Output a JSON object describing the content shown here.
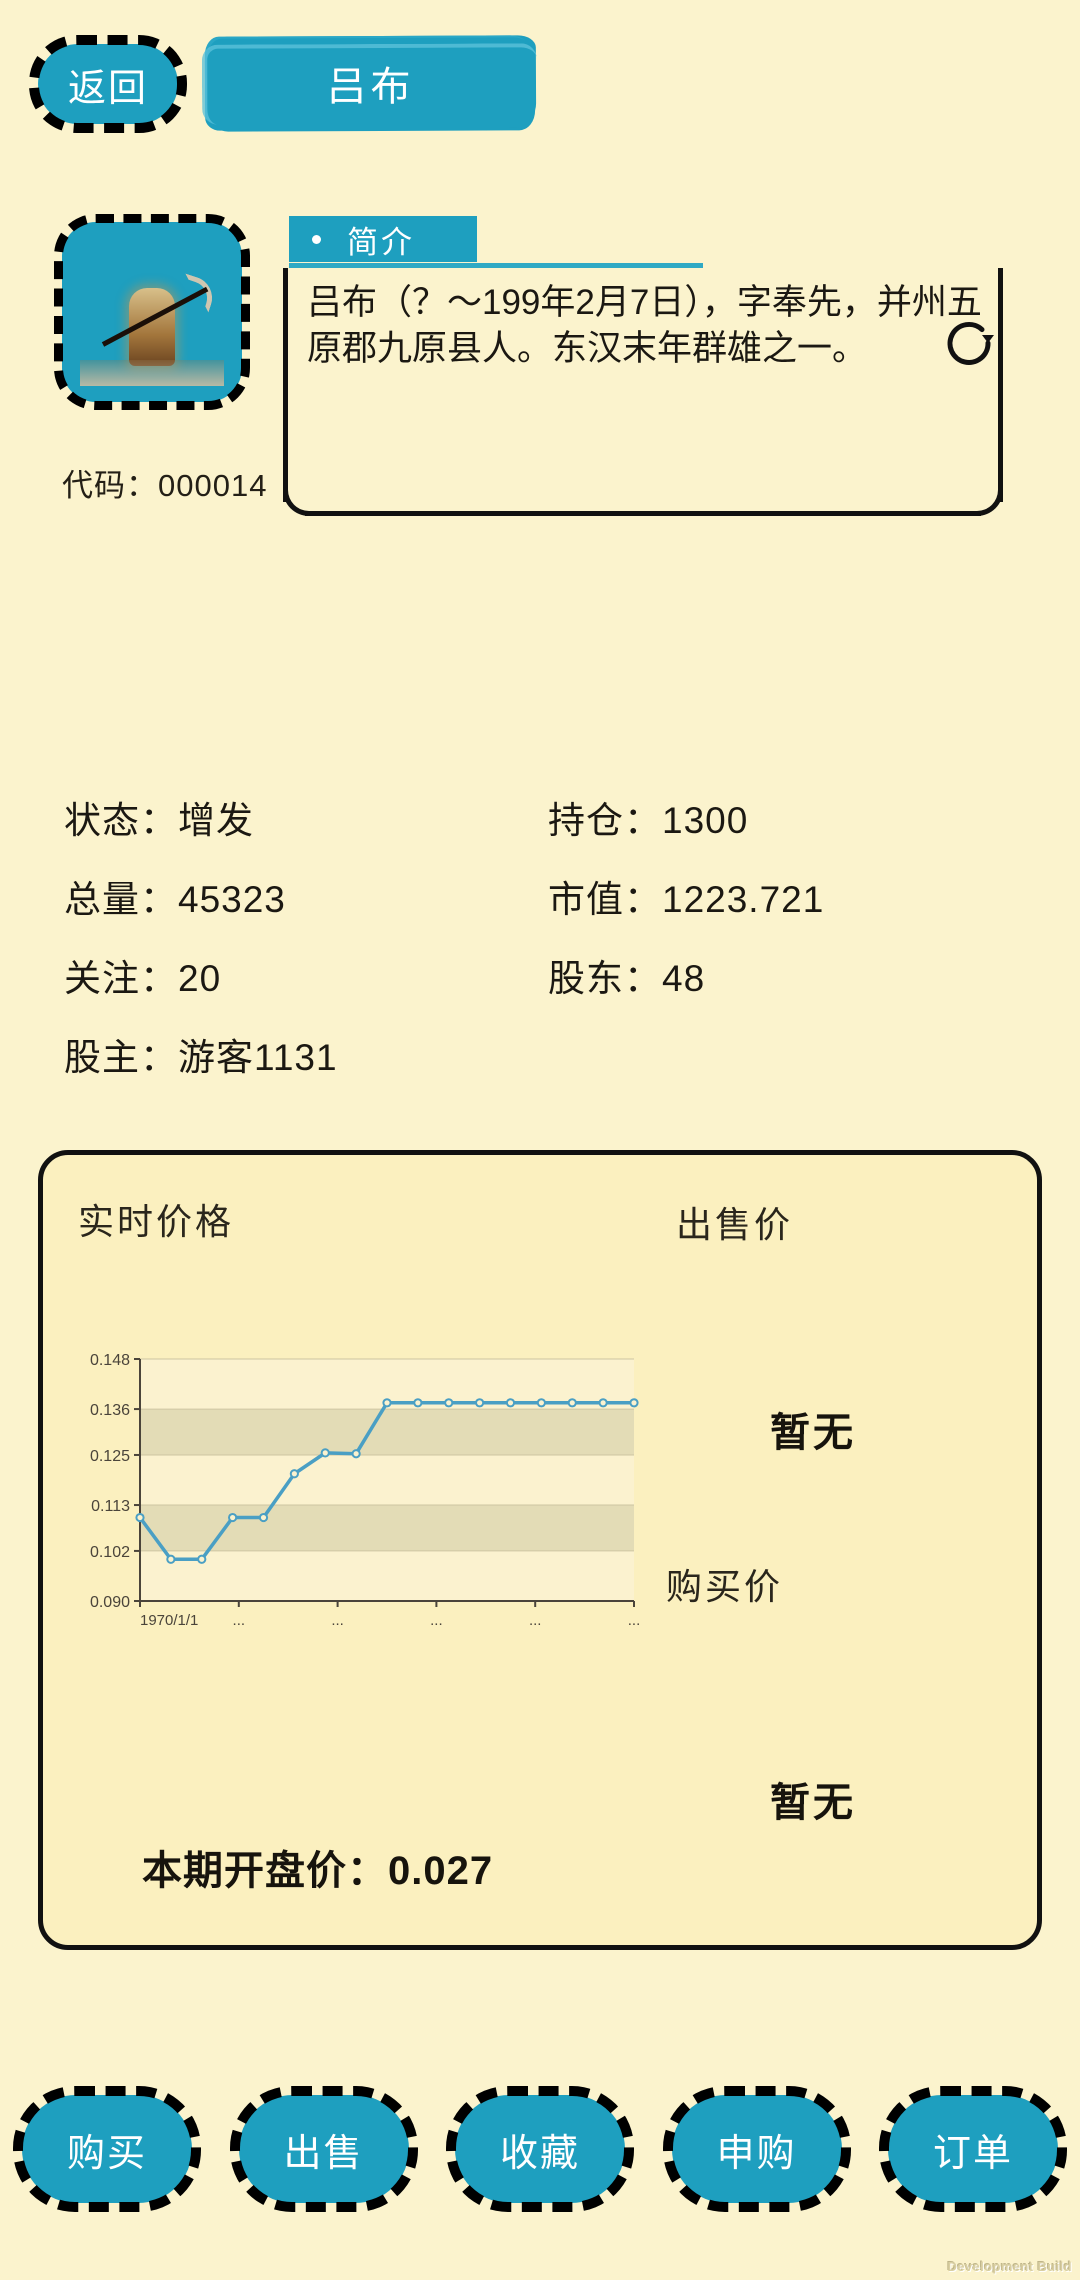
{
  "header": {
    "back_label": "返回",
    "title": "吕布"
  },
  "profile": {
    "portrait_alt": "character-portrait",
    "code_label": "代码：000014",
    "intro_tab_label": "简介",
    "refresh_icon": "refresh-icon",
    "intro_text": "吕布（？～199年2月7日），字奉先，并州五原郡九原县人。东汉末年群雄之一。"
  },
  "stats": {
    "state": {
      "key": "状态：",
      "value": "增发"
    },
    "total": {
      "key": "总量：",
      "value": "45323"
    },
    "follow": {
      "key": "关注：",
      "value": "20"
    },
    "owner": {
      "key": "股主：",
      "value": "游客1131"
    },
    "holding": {
      "key": "持仓：",
      "value": "1300"
    },
    "market_val": {
      "key": "市值：",
      "value": "1223.721"
    },
    "holders": {
      "key": "股东：",
      "value": "48"
    }
  },
  "price_panel": {
    "realtime_label": "实时价格",
    "sell_label": "出售价",
    "sell_value": "暂无",
    "buy_label": "购买价",
    "buy_value": "暂无",
    "open_price_label": "本期开盘价：0.027"
  },
  "chart_data": {
    "type": "line",
    "title": "实时价格",
    "xlabel": "",
    "ylabel": "",
    "grid": true,
    "legend": false,
    "line_color": "#4a9fc4",
    "marker": "circle",
    "ylim": [
      0.09,
      0.148
    ],
    "yticks": [
      "0.090",
      "0.102",
      "0.113",
      "0.125",
      "0.136",
      "0.148"
    ],
    "ytick_values": [
      0.09,
      0.102,
      0.113,
      0.125,
      0.136,
      0.148
    ],
    "xticks": [
      "1970/1/1",
      "...",
      "...",
      "...",
      "...",
      "..."
    ],
    "x": [
      0,
      1,
      2,
      3,
      4,
      5,
      6,
      7,
      8,
      9,
      10,
      11,
      12,
      13,
      14,
      15,
      16
    ],
    "values": [
      0.11,
      0.1,
      0.1,
      0.11,
      0.11,
      0.1205,
      0.1255,
      0.1253,
      0.1375,
      0.1375,
      0.1375,
      0.1375,
      0.1375,
      0.1375,
      0.1375,
      0.1375,
      0.1375
    ]
  },
  "bottom_actions": [
    {
      "label": "购买",
      "name": "buy"
    },
    {
      "label": "出售",
      "name": "sell"
    },
    {
      "label": "收藏",
      "name": "favorite"
    },
    {
      "label": "申购",
      "name": "subscribe"
    },
    {
      "label": "订单",
      "name": "orders"
    }
  ],
  "watermark": "Development Build",
  "colors": {
    "accent": "#1e9fbf",
    "background": "#fbf3cd",
    "card_background": "#fbf0bf",
    "ink": "#111111",
    "chart_line": "#4a9fc4"
  }
}
